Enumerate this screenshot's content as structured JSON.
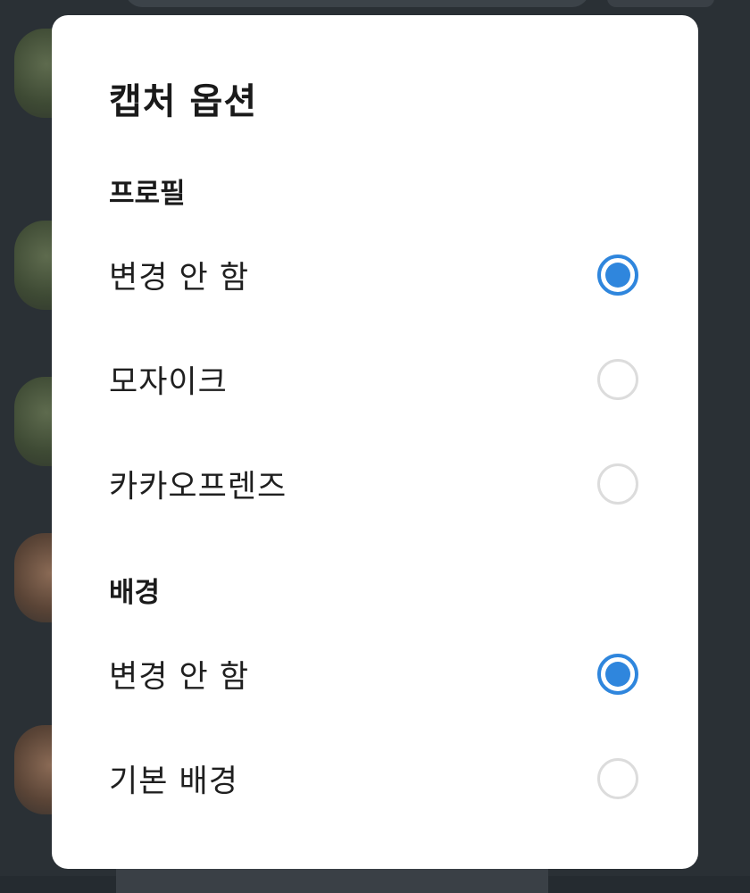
{
  "dialog": {
    "title": "캡처 옵션",
    "sections": [
      {
        "label": "프로필",
        "options": [
          {
            "label": "변경 안 함",
            "selected": true
          },
          {
            "label": "모자이크",
            "selected": false
          },
          {
            "label": "카카오프렌즈",
            "selected": false
          }
        ]
      },
      {
        "label": "배경",
        "options": [
          {
            "label": "변경 안 함",
            "selected": true
          },
          {
            "label": "기본 배경",
            "selected": false
          }
        ]
      }
    ]
  },
  "colors": {
    "accent": "#2f86dd",
    "radio_border": "#dcdcdc",
    "dialog_bg": "#ffffff",
    "backdrop": "#2a3035"
  },
  "icons": {
    "radio_selected": "radio-selected-icon",
    "radio_unselected": "radio-unselected-icon"
  }
}
